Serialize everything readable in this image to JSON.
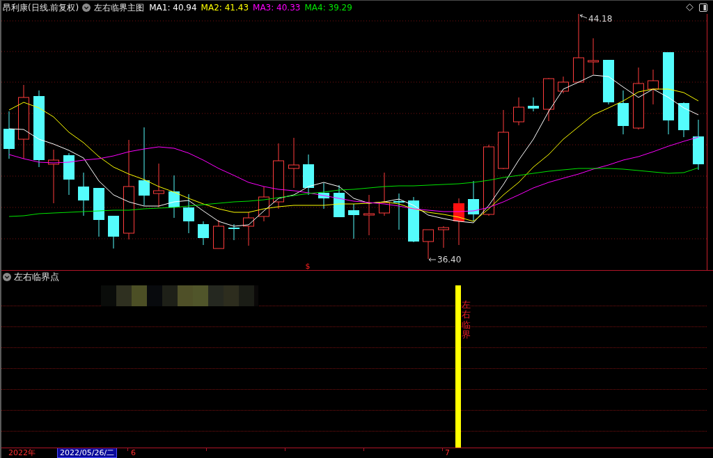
{
  "header": {
    "stock": "昂利康(日线.前复权)",
    "indicator": "左右临界主图",
    "moving_averages": [
      {
        "label": "MA1: 40.94",
        "color": "#ffffff"
      },
      {
        "label": "MA2: 41.43",
        "color": "#ffff00"
      },
      {
        "label": "MA3: 40.33",
        "color": "#ff00ff"
      },
      {
        "label": "MA4: 39.29",
        "color": "#00e600"
      }
    ]
  },
  "main_chart": {
    "high_label": "44.18",
    "low_label": "36.40",
    "marker": "$"
  },
  "sub_chart": {
    "title": "左右临界点",
    "signal_text": "左右临界"
  },
  "time_axis": {
    "year": "2022年",
    "cursor_date": "2022/05/26/二",
    "months": [
      "6",
      "7"
    ]
  }
}
